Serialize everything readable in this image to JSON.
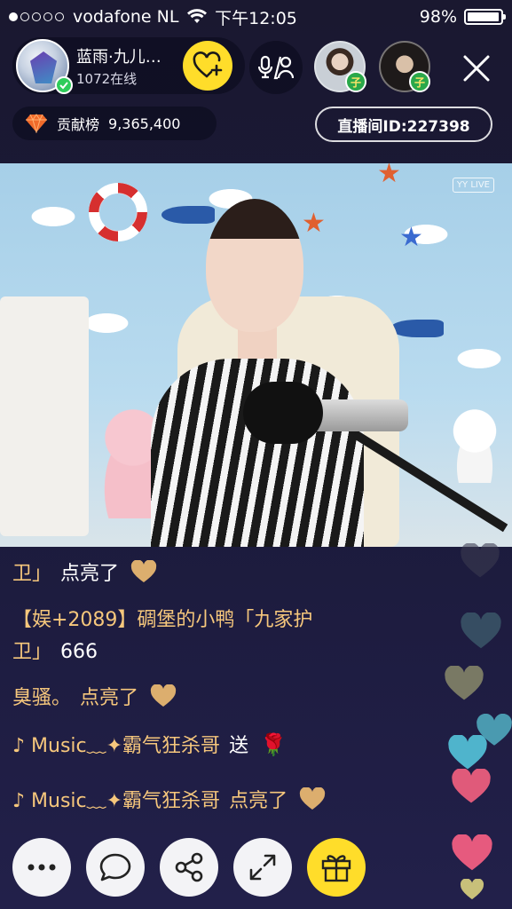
{
  "status_bar": {
    "carrier": "vodafone NL",
    "time": "下午12:05",
    "battery_percent": "98%",
    "battery_level": 0.98,
    "signal_dots_filled": 1,
    "signal_dots_total": 5
  },
  "host": {
    "name": "蓝雨·九儿…",
    "online": "1072在线",
    "verified_icon": "check-icon",
    "follow_icon": "heart-plus-icon"
  },
  "toolbar": {
    "mic_icon": "mic-user-icon",
    "close_icon": "close-icon"
  },
  "guests": [
    {
      "badge": "子"
    },
    {
      "badge": "子"
    }
  ],
  "contribution": {
    "icon": "diamond-icon",
    "label": "贡献榜",
    "value": "9,365,400"
  },
  "room": {
    "id_label": "直播间ID:227398"
  },
  "video": {
    "watermark": "YY LIVE"
  },
  "chat": {
    "messages": [
      {
        "user": "卫」",
        "text": "点亮了",
        "icon": "heart",
        "faded": false
      },
      {
        "user": "【娱+2089】碉堡的小鸭「九家护",
        "text": "",
        "icon": "",
        "faded": false
      },
      {
        "user": "卫」",
        "text": "666",
        "icon": "",
        "faded": false
      },
      {
        "user": "臭骚。",
        "text": "点亮了",
        "icon": "heart",
        "faded": false
      },
      {
        "user": "♪ Music﹏✦霸气狂杀哥",
        "text": "送",
        "icon": "rose",
        "faded": false
      },
      {
        "user": "♪ Music﹏✦霸气狂杀哥",
        "text": "点亮了",
        "icon": "heart",
        "faded": false
      }
    ]
  },
  "colors": {
    "accent_yellow": "#ffdd2a",
    "chat_name": "#f6c77c",
    "heart_tan": "#dcae6e",
    "background": "#1b1a3a"
  },
  "bottom_bar": {
    "more_icon": "more-icon",
    "chat_icon": "chat-bubble-icon",
    "share_icon": "share-icon",
    "fullscreen_icon": "expand-icon",
    "gift_icon": "gift-icon"
  }
}
